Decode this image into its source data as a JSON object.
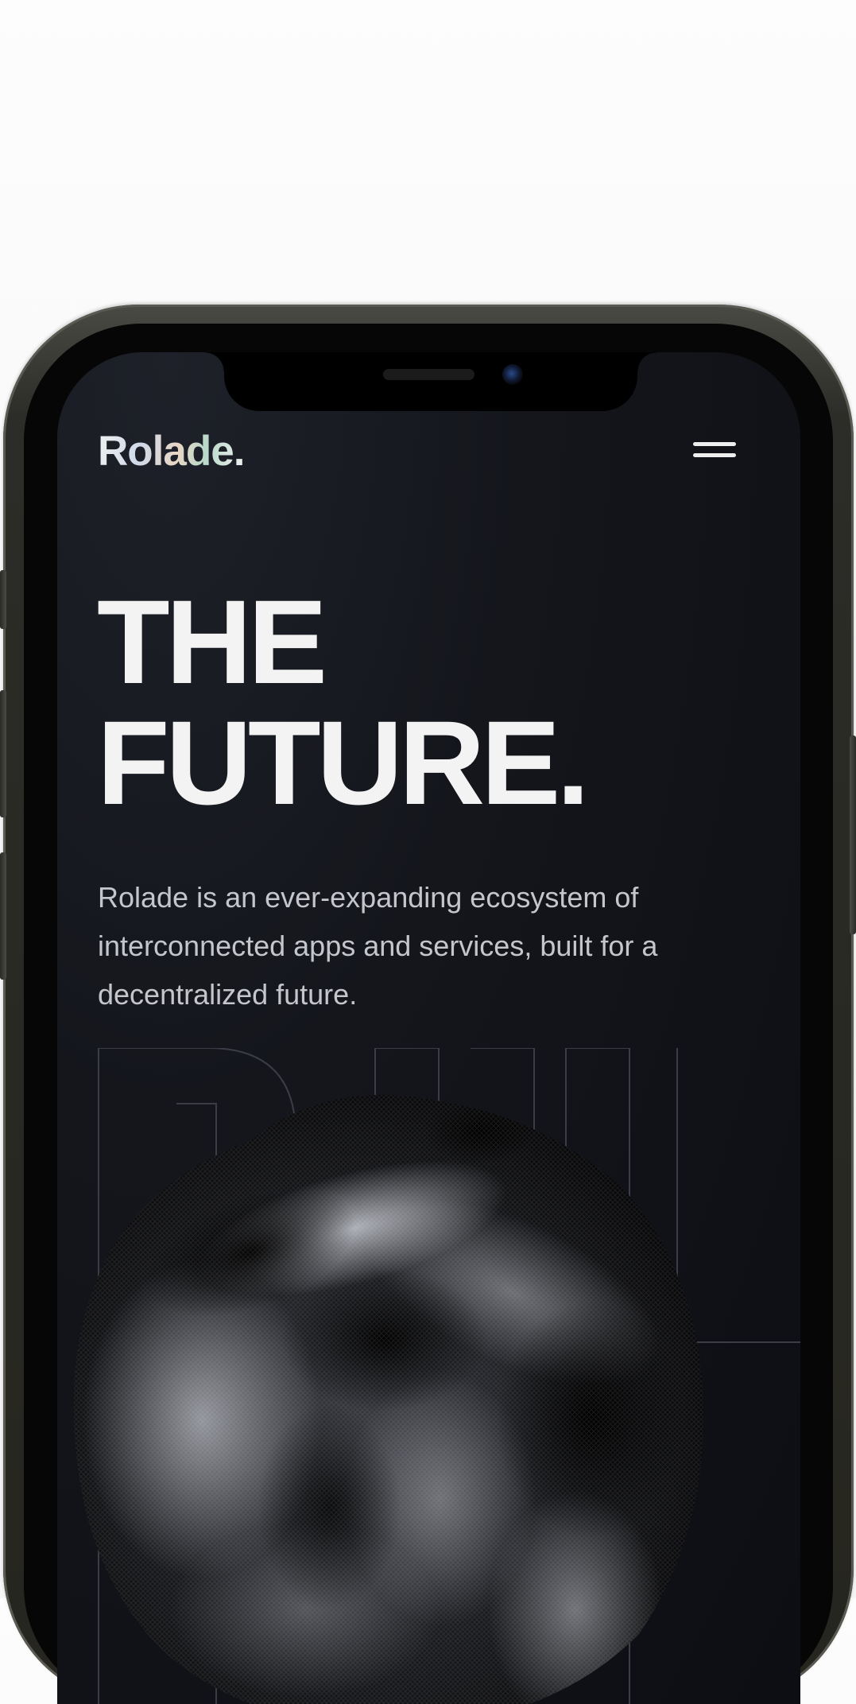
{
  "brand": {
    "logo_text": "Rolade."
  },
  "header": {
    "menu_icon": "hamburger-menu-icon"
  },
  "hero": {
    "title_line_1": "THE",
    "title_line_2": "FUTURE.",
    "description": "Rolade is an ever-expanding ecosystem of interconnected apps and services, built for a decentralized future."
  },
  "colors": {
    "page_background": "#f5f5f6",
    "screen_background": "#14161c",
    "headline": "#f3f3f3",
    "body_text": "#c4c6cb",
    "phone_frame": "#2c2c28"
  }
}
